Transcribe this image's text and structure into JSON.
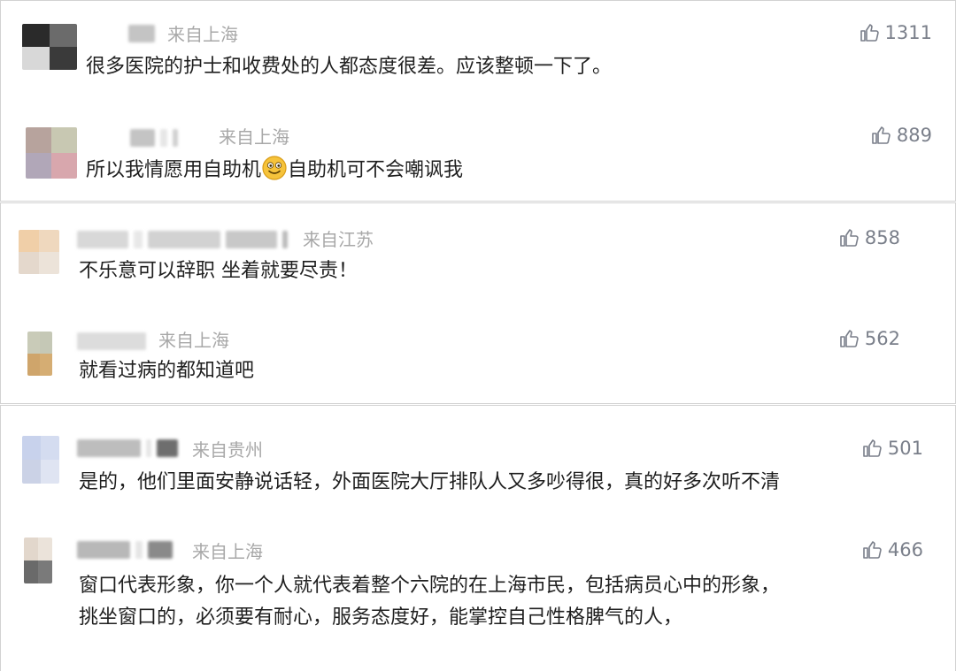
{
  "comments": [
    {
      "location": "来自上海",
      "likes": "1311",
      "text": "很多医院的护士和收费处的人都态度很差。应该整顿一下了。"
    },
    {
      "location": "来自上海",
      "likes": "889",
      "text_before": "所以我情愿用自助机",
      "text_after": "自助机可不会嘲讽我",
      "emoji": "smiling-face-emoji"
    },
    {
      "location": "来自江苏",
      "likes": "858",
      "text": "不乐意可以辞职 坐着就要尽责！"
    },
    {
      "location": "来自上海",
      "likes": "562",
      "text": "就看过病的都知道吧"
    },
    {
      "location": "来自贵州",
      "likes": "501",
      "text": "是的，他们里面安静说话轻，外面医院大厅排队人又多吵得很，真的好多次听不清"
    },
    {
      "location": "来自上海",
      "likes": "466",
      "text_line1": "窗口代表形象，你一个人就代表着整个六院的在上海市民，包括病员心中的形象，",
      "text_line2": "挑坐窗口的，必须要有耐心，服务态度好，能掌控自己性格脾气的人，"
    }
  ],
  "icons": {
    "like": "thumbs-up-icon"
  },
  "colors": {
    "meta": "#a8a8a8",
    "like": "#7a7f8a",
    "text": "#1f1f1f",
    "border": "#d2d2d2"
  }
}
